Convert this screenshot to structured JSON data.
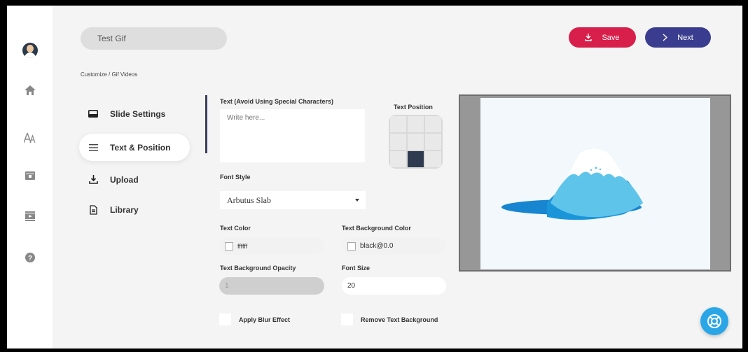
{
  "header": {
    "project_name": "Test Gif",
    "save_label": "Save",
    "next_label": "Next"
  },
  "breadcrumb": "Customize  /  Gif Videos",
  "rail_icons": [
    "avatar",
    "home-icon",
    "text-icon",
    "gift-icon",
    "video-icon",
    "help-icon"
  ],
  "nav": [
    {
      "label": "Slide Settings",
      "icon": "slide-icon"
    },
    {
      "label": "Text & Position",
      "icon": "menu-icon",
      "active": true
    },
    {
      "label": "Upload",
      "icon": "upload-icon"
    },
    {
      "label": "Library",
      "icon": "library-icon"
    }
  ],
  "form": {
    "text_label": "Text (Avoid Using Special Characters)",
    "text_placeholder": "Write here...",
    "position_label": "Text Position",
    "position_selected": "bottom-center",
    "font_style_label": "Font Style",
    "font_style_value": "Arbutus Slab",
    "text_color_label": "Text Color",
    "text_color_value": "ffffff",
    "text_bg_color_label": "Text Background Color",
    "text_bg_color_value": "black@0.0",
    "text_bg_opacity_label": "Text Background Opacity",
    "text_bg_opacity_value": "1",
    "font_size_label": "Font Size",
    "font_size_value": "20",
    "blur_label": "Apply Blur Effect",
    "remove_bg_label": "Remove Text Background"
  },
  "colors": {
    "save": "#d81e4a",
    "next": "#3a3d8f",
    "fab": "#2aa6e6"
  }
}
